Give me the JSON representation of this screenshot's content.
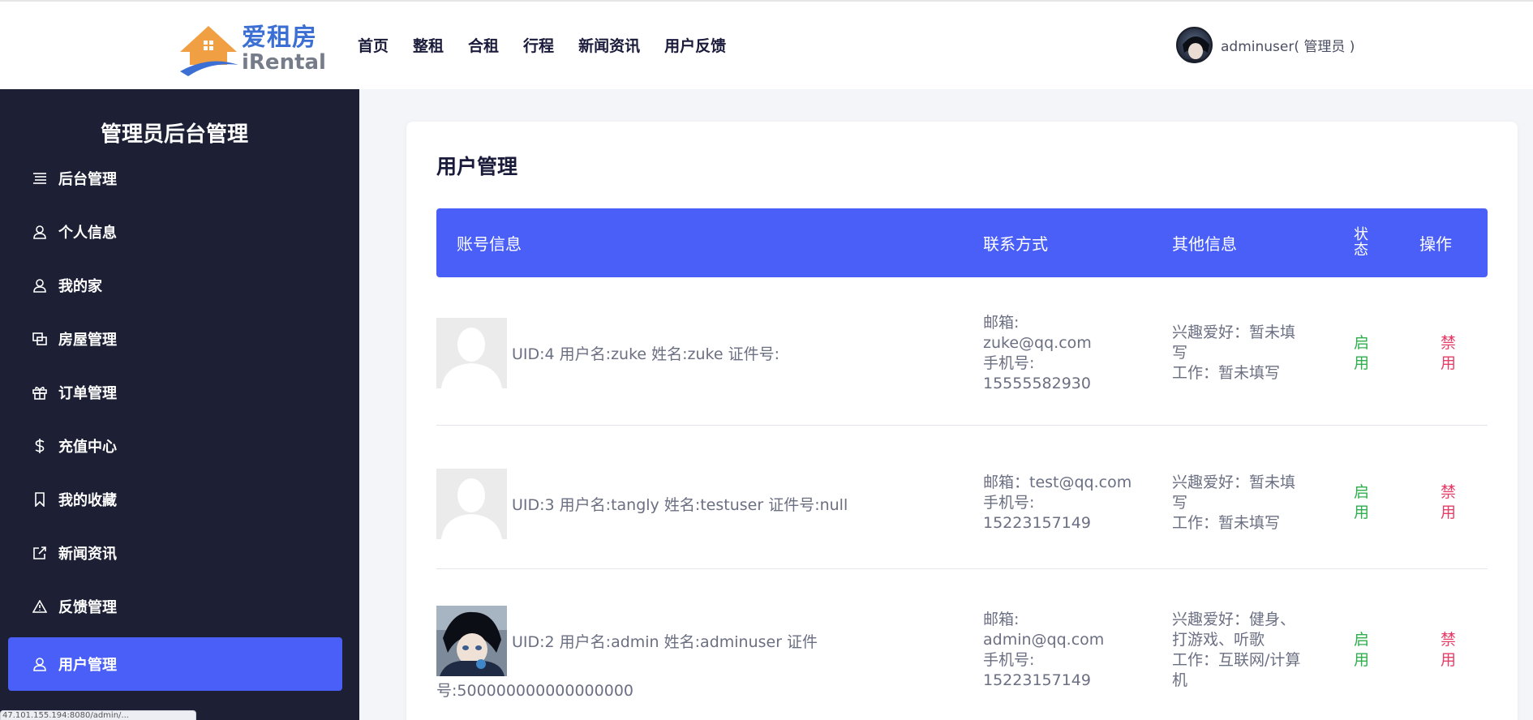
{
  "brand": {
    "name_cn": "爱租房",
    "name_en": "iRental",
    "colors": {
      "accent": "#4a5ff7",
      "sidebar_bg": "#1d2035",
      "enable": "#2fae4d",
      "disable": "#e53d67"
    }
  },
  "nav": [
    {
      "label": "首页"
    },
    {
      "label": "整租"
    },
    {
      "label": "合租"
    },
    {
      "label": "行程"
    },
    {
      "label": "新闻资讯"
    },
    {
      "label": "用户反馈"
    }
  ],
  "user": {
    "name": "adminuser( 管理员 )"
  },
  "sidebar": {
    "title": "管理员后台管理",
    "items": [
      {
        "label": "后台管理",
        "icon": "list-icon"
      },
      {
        "label": "个人信息",
        "icon": "user-icon"
      },
      {
        "label": "我的家",
        "icon": "user-icon"
      },
      {
        "label": "房屋管理",
        "icon": "copy-icon"
      },
      {
        "label": "订单管理",
        "icon": "gift-icon"
      },
      {
        "label": "充值中心",
        "icon": "dollar-icon"
      },
      {
        "label": "我的收藏",
        "icon": "bookmark-icon"
      },
      {
        "label": "新闻资讯",
        "icon": "external-link-icon"
      },
      {
        "label": "反馈管理",
        "icon": "alert-triangle-icon"
      },
      {
        "label": "用户管理",
        "icon": "user-icon",
        "active": true
      }
    ]
  },
  "status_bar": {
    "url": "47.101.155.194:8080/admin/..."
  },
  "main": {
    "title": "用户管理",
    "columns": {
      "account": "账号信息",
      "contact": "联系方式",
      "other": "其他信息",
      "status_1": "状",
      "status_2": "态",
      "action": "操作"
    },
    "rows": [
      {
        "account": "UID:4 用户名:zuke 姓名:zuke 证件号:",
        "email_label": "邮箱:",
        "email": "zuke@qq.com",
        "phone_label": "手机号:",
        "phone": "15555582930",
        "hobby_1": "兴趣爱好：暂未填",
        "hobby_2": "写",
        "job_1": "工作：暂未填写",
        "job_2": "",
        "state_1": "启",
        "state_2": "用",
        "op_1": "禁",
        "op_2": "用",
        "avatar": "default-avatar"
      },
      {
        "account": "UID:3 用户名:tangly 姓名:testuser 证件号:null",
        "email_label": "邮箱：test@qq.com",
        "email": "",
        "phone_label": "手机号:",
        "phone": "15223157149",
        "hobby_1": "兴趣爱好：暂未填",
        "hobby_2": "写",
        "job_1": "工作：暂未填写",
        "job_2": "",
        "state_1": "启",
        "state_2": "用",
        "op_1": "禁",
        "op_2": "用",
        "avatar": "default-avatar"
      },
      {
        "account_1": "UID:2 用户名:admin 姓名:adminuser 证件",
        "account_2": "号:500000000000000000",
        "email_label": "邮箱:",
        "email": "admin@qq.com",
        "phone_label": "手机号:",
        "phone": "15223157149",
        "hobby_1": "兴趣爱好：健身、",
        "hobby_2": "打游戏、听歌",
        "job_1": "工作：互联网/计算",
        "job_2": "机",
        "state_1": "启",
        "state_2": "用",
        "op_1": "禁",
        "op_2": "用",
        "avatar": "anime-avatar"
      }
    ]
  }
}
